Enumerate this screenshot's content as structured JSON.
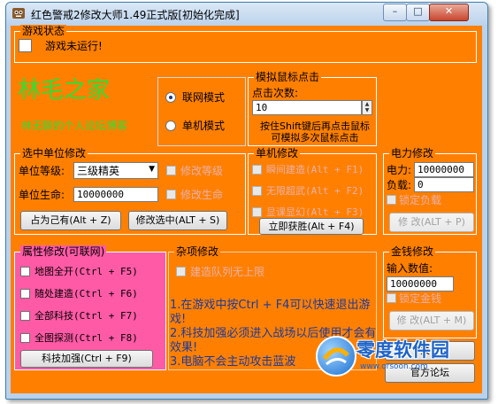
{
  "window": {
    "title": "红色警戒2修改大师1.49正式版[初始化完成]",
    "buttons": {
      "minimize": "–",
      "maximize": "□",
      "close": "✕"
    }
  },
  "colors": {
    "panel": "#ff8000",
    "pink_panel": "#ff5aa6",
    "logo_green": "#33dd33",
    "info_blue": "#1a3aa0"
  },
  "game_status": {
    "title": "游戏状态",
    "status_text": "游戏未运行!"
  },
  "logo": {
    "title": "林毛之家",
    "subtitle": "林无聊的个人论坛博客"
  },
  "mode": {
    "network_label": "联网模式",
    "single_label": "单机模式",
    "selected": "联网模式"
  },
  "mouse_click": {
    "title": "模拟鼠标点击",
    "count_label": "点击次数:",
    "count_value": "10",
    "hint": "按住Shift键后再点击鼠标可模拟多次鼠标点击"
  },
  "unit_edit": {
    "title": "选中单位修改",
    "level_label": "单位等级:",
    "level_value": "三级精英",
    "hp_label": "单位生命:",
    "hp_value": "10000000",
    "edit_level_label": "修改等级",
    "edit_hp_label": "修改生命",
    "own_button": "占为己有(Alt + Z)",
    "modify_button": "修改选中(ALT + S)"
  },
  "single_edit": {
    "title": "单机修改",
    "items": [
      {
        "label": "瞬间建造(Alt + F1)"
      },
      {
        "label": "无限超武(Alt + F2)"
      },
      {
        "label": "显课显幻(Alt + F3)"
      }
    ],
    "win_button": "立即获胜(Alt + F4)"
  },
  "power": {
    "title": "电力修改",
    "power_label": "电力:",
    "power_value": "10000000",
    "load_label": "负载:",
    "load_value": "0",
    "lock_label": "锁定负载",
    "modify_button": "修 改(ALT + P)"
  },
  "attributes": {
    "title": "属性修改(可联网)",
    "items": [
      {
        "label": "地图全开(Ctrl + F5)"
      },
      {
        "label": "随处建造(Ctrl + F6)"
      },
      {
        "label": "全部科技(Ctrl + F7)"
      },
      {
        "label": "全图探测(Ctrl + F8)"
      }
    ],
    "boost_button": "科技加强(Ctrl + F9)"
  },
  "misc": {
    "title": "杂项修改",
    "queue_label": "建造队列无上限",
    "notes": [
      "1.在游戏中按Ctrl + F4可以快速退出游戏!",
      "2.科技加强必须进入战场以后使用才会有效果!",
      "3.电脑不会主动攻击蓝波"
    ]
  },
  "money": {
    "title": "金钱修改",
    "input_label": "输入数值:",
    "input_value": "10000000",
    "lock_label": "锁定金钱",
    "modify_button": "修 改(ALT + M)"
  },
  "about_button": "关于",
  "forum_button": "官方论坛",
  "watermark": {
    "brand": "零度软件园",
    "url": "www.orsoon.com"
  }
}
